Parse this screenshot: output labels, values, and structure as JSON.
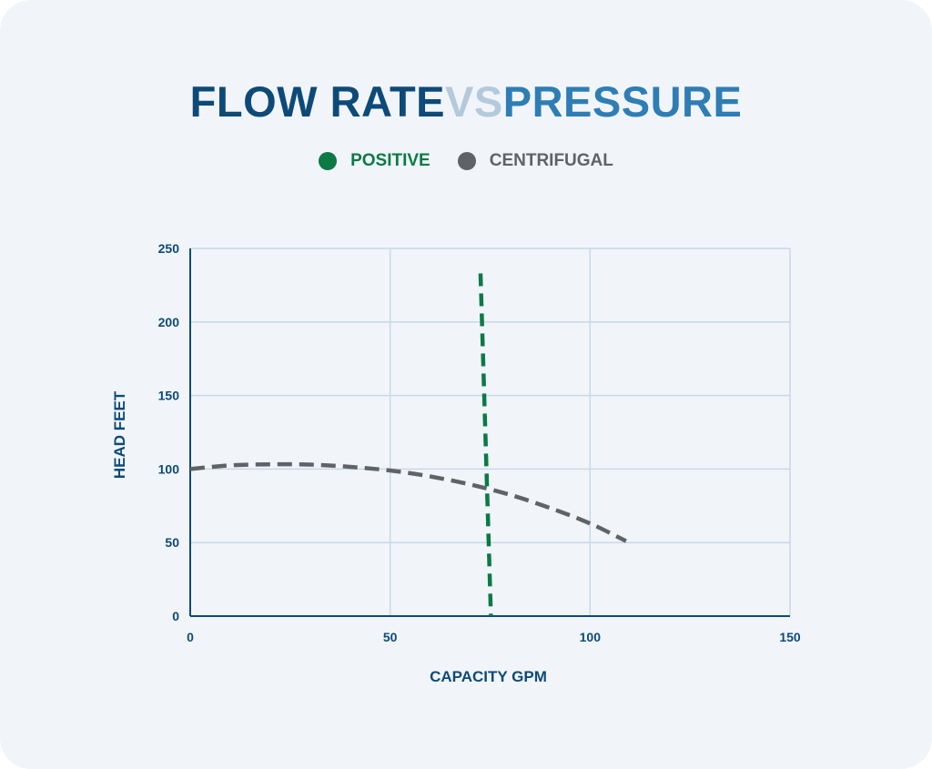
{
  "title": {
    "part1": "FLOW RATE ",
    "part2": "VS ",
    "part3": "PRESSURE",
    "colors": [
      "#0d4a78",
      "#b5c9dc",
      "#2e7db5"
    ]
  },
  "chart_data": {
    "type": "line",
    "title": "FLOW RATE VS PRESSURE",
    "xlabel": "CAPACITY GPM",
    "ylabel": "HEAD FEET",
    "xlim": [
      0,
      150
    ],
    "ylim": [
      0,
      250
    ],
    "xticks": [
      0,
      50,
      100,
      150
    ],
    "yticks": [
      0,
      50,
      100,
      150,
      200,
      250
    ],
    "grid": true,
    "legend_position": "top-center",
    "series": [
      {
        "name": "POSITIVE",
        "color": "#0b7a45",
        "style": "dashed",
        "x": [
          72.6,
          75.2
        ],
        "y": [
          233,
          0
        ]
      },
      {
        "name": "CENTRIFUGAL",
        "color": "#606366",
        "style": "dashed",
        "x": [
          0,
          10,
          20,
          30,
          40,
          50,
          60,
          70,
          80,
          90,
          100,
          109
        ],
        "y": [
          100,
          102.5,
          103.2,
          103,
          101.5,
          99,
          95,
          89.5,
          82.5,
          73.5,
          63,
          51
        ]
      }
    ]
  }
}
